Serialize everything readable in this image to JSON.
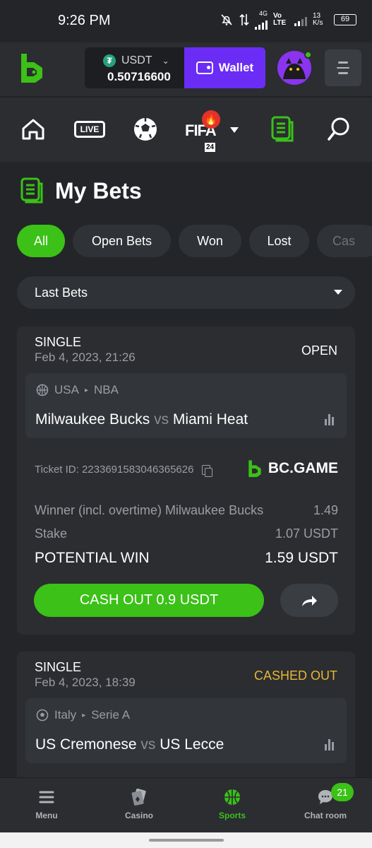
{
  "status_bar": {
    "time": "9:26 PM",
    "net_4g": "4G",
    "volte": "Vo LTE",
    "speed": "13 K/s",
    "battery": "69"
  },
  "header": {
    "currency": {
      "code": "USDT",
      "symbol": "₮",
      "balance": "0.50716600"
    },
    "wallet_label": "Wallet"
  },
  "category_nav": {
    "live_label": "LIVE",
    "fifa_label": "FIFA",
    "fifa_year": "24"
  },
  "page": {
    "title": "My Bets"
  },
  "filters": [
    {
      "label": "All",
      "active": true
    },
    {
      "label": "Open Bets"
    },
    {
      "label": "Won"
    },
    {
      "label": "Lost"
    },
    {
      "label": "Cas"
    }
  ],
  "select": {
    "value": "Last Bets"
  },
  "bets": [
    {
      "type": "SINGLE",
      "date": "Feb 4, 2023, 21:26",
      "status": "OPEN",
      "country": "USA",
      "league": "NBA",
      "home": "Milwaukee Bucks",
      "vs": "vs",
      "away": "Miami Heat",
      "ticket": "Ticket ID: 2233691583046365626",
      "brand": "BC.GAME",
      "market": "Winner (incl. overtime) Milwaukee Bucks",
      "odds": "1.49",
      "stake_label": "Stake",
      "stake": "1.07 USDT",
      "potential_label": "POTENTIAL WIN",
      "potential": "1.59 USDT",
      "cashout_label": "CASH OUT 0.9 USDT"
    },
    {
      "type": "SINGLE",
      "date": "Feb 4, 2023, 18:39",
      "status": "CASHED OUT",
      "country": "Italy",
      "league": "Serie A",
      "home": "US Cremonese",
      "vs": "vs",
      "away": "US Lecce"
    }
  ],
  "bottom_nav": [
    {
      "label": "Menu"
    },
    {
      "label": "Casino"
    },
    {
      "label": "Sports",
      "active": true
    },
    {
      "label": "Chat room",
      "badge": "21"
    }
  ],
  "colors": {
    "accent": "#3bc117",
    "wallet": "#6b2cf5",
    "cashed": "#e8b632",
    "bg": "#232529",
    "card": "#2b2d31"
  }
}
